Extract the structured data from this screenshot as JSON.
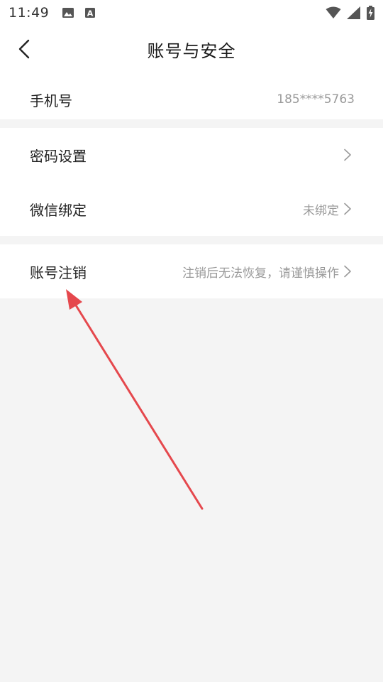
{
  "status_bar": {
    "time": "11:49",
    "icons": [
      "image-icon",
      "a-text-icon",
      "wifi-icon",
      "signal-icon",
      "battery-charging-icon"
    ]
  },
  "nav": {
    "title": "账号与安全",
    "back_icon": "chevron-left-icon"
  },
  "rows": {
    "phone": {
      "label": "手机号",
      "value": "185****5763"
    },
    "password": {
      "label": "密码设置",
      "value": ""
    },
    "wechat": {
      "label": "微信绑定",
      "value": "未绑定"
    },
    "cancel": {
      "label": "账号注销",
      "value": "注销后无法恢复，请谨慎操作"
    }
  },
  "colors": {
    "annotation_arrow": "#e5484d",
    "background": "#f4f4f4",
    "muted_text": "#9a9a9a"
  }
}
